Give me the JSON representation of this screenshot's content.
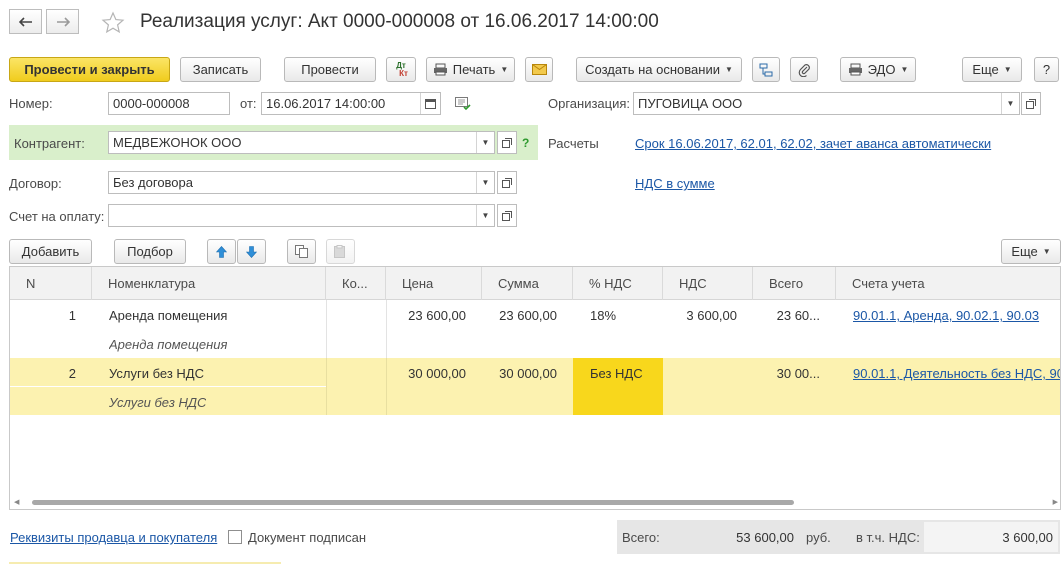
{
  "window": {
    "title": "Реализация услуг: Акт 0000-000008 от 16.06.2017 14:00:00"
  },
  "nav": {
    "back": "back-arrow-icon",
    "forward": "forward-arrow-icon",
    "favorite": "star-icon"
  },
  "toolbar": {
    "post_close": "Провести и закрыть",
    "save": "Записать",
    "post": "Провести",
    "dtkt_dt": "Дт",
    "dtkt_kt": "Кт",
    "print": "Печать",
    "create_based": "Создать на основании",
    "edo": "ЭДО",
    "more": "Еще",
    "help": "?"
  },
  "form": {
    "number_label": "Номер:",
    "number": "0000-000008",
    "date_label": "от:",
    "date": "16.06.2017 14:00:00",
    "org_label": "Организация:",
    "org": "ПУГОВИЦА ООО",
    "counterparty_label": "Контрагент:",
    "counterparty": "МЕДВЕЖОНОК ООО",
    "settlements_label": "Расчеты",
    "settlements_link": "Срок 16.06.2017, 62.01, 62.02, зачет аванса автоматически",
    "contract_label": "Договор:",
    "contract": "Без договора",
    "vat_link": "НДС в сумме",
    "invoice_label": "Счет на оплату:",
    "invoice": ""
  },
  "table_toolbar": {
    "add": "Добавить",
    "pick": "Подбор",
    "more": "Еще"
  },
  "table": {
    "columns": [
      "N",
      "Номенклатура",
      "Ко...",
      "Цена",
      "Сумма",
      "% НДС",
      "НДС",
      "Всего",
      "Счета учета"
    ],
    "rows": [
      {
        "n": "1",
        "name": "Аренда помещения",
        "content": "Аренда помещения",
        "qty": "",
        "price": "23 600,00",
        "sum": "23 600,00",
        "vat_rate": "18%",
        "vat": "3 600,00",
        "total": "23 60...",
        "accounts": "90.01.1, Аренда, 90.02.1, 90.03"
      },
      {
        "n": "2",
        "name": "Услуги без НДС",
        "content": "Услуги без НДС",
        "qty": "",
        "price": "30 000,00",
        "sum": "30 000,00",
        "vat_rate": "Без НДС",
        "vat": "",
        "total": "30 00...",
        "accounts": "90.01.1, Деятельность без НДС, 90"
      }
    ]
  },
  "footer": {
    "requisites_link": "Реквизиты продавца и покупателя",
    "signed_label": "Документ подписан",
    "total_label": "Всего:",
    "total": "53 600,00",
    "currency": "руб.",
    "vat_label": "в т.ч. НДС:",
    "vat": "3 600,00"
  },
  "colors": {
    "primary": "#f3d02a",
    "highlight_row": "#fcf2b0",
    "selected_cell": "#f8d71c",
    "link": "#1b57a6",
    "counterparty_bg": "#d9efcb"
  }
}
